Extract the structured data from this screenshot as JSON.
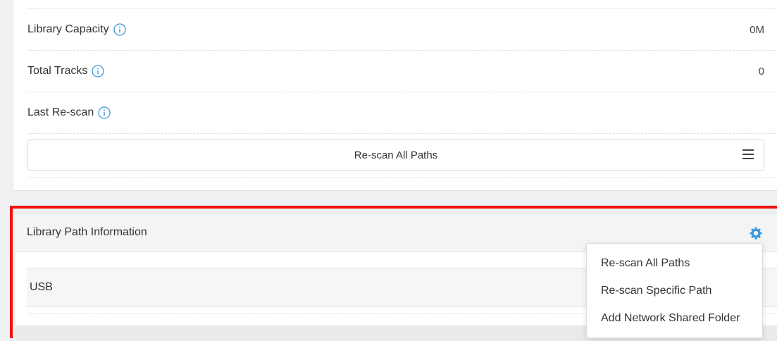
{
  "library_stats": {
    "rows": [
      {
        "label": "Library Capacity",
        "value": "0M",
        "icon": "info-icon"
      },
      {
        "label": "Total Tracks",
        "value": "0",
        "icon": "info-icon"
      },
      {
        "label": "Last Re-scan",
        "value": "",
        "icon": "info-icon"
      }
    ],
    "rescan_button_label": "Re-scan All Paths",
    "menu_icon": "hamburger-icon"
  },
  "library_path": {
    "title": "Library Path Information",
    "settings_icon": "gear-icon",
    "paths": [
      {
        "name": "USB"
      }
    ]
  },
  "context_menu": {
    "items": [
      {
        "label": "Re-scan All Paths"
      },
      {
        "label": "Re-scan Specific Path"
      },
      {
        "label": "Add Network Shared Folder"
      }
    ]
  },
  "colors": {
    "accent_blue": "#3a9ad9",
    "highlight_red": "#ef1010"
  }
}
